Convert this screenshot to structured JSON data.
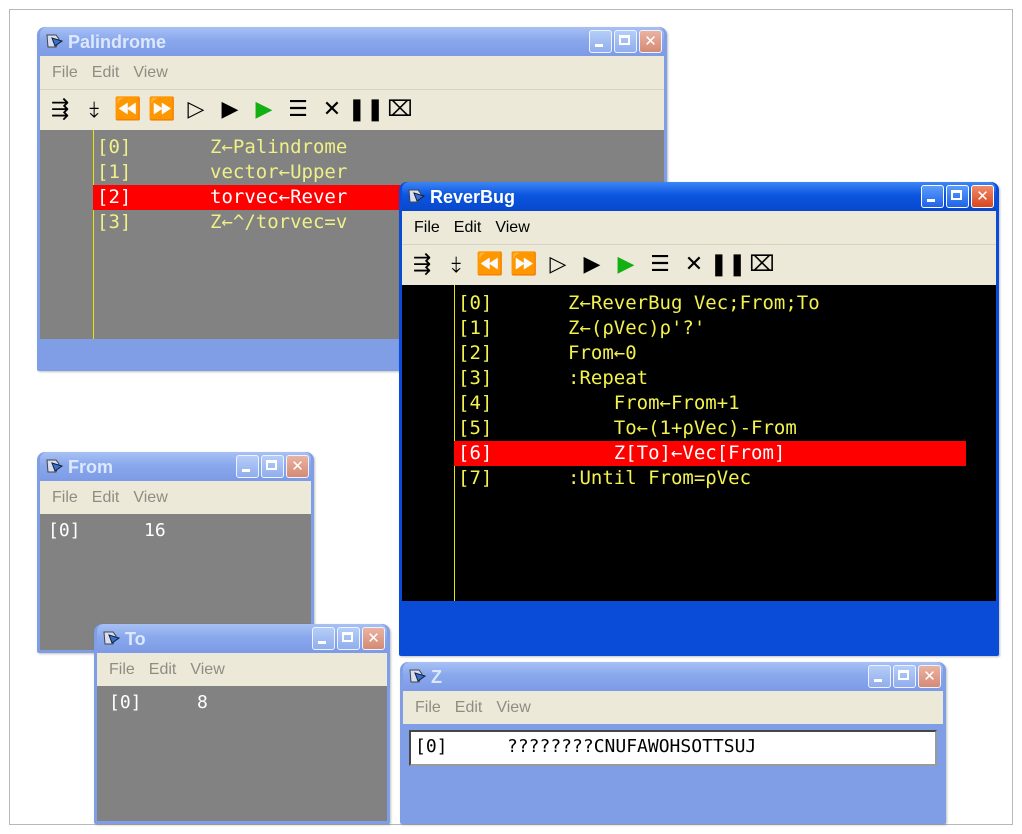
{
  "menu": [
    "File",
    "Edit",
    "View"
  ],
  "toolbar_icons": [
    "step-over-icon",
    "step-into-icon",
    "rewind-icon",
    "fast-forward-icon",
    "run-line-icon",
    "run-icon",
    "continue-icon",
    "edit-trace-icon",
    "quit-icon",
    "pause-icon",
    "interrupt-icon"
  ],
  "palindrome": {
    "title": "Palindrome",
    "lines": [
      {
        "n": "[0]",
        "t": "Z←Palindrome"
      },
      {
        "n": "[1]",
        "t": "vector←Upper"
      },
      {
        "n": "[2]",
        "t": "torvec←Rever",
        "hl": true
      },
      {
        "n": "[3]",
        "t": "Z←^/torvec=v"
      }
    ]
  },
  "reverbug": {
    "title": "ReverBug",
    "lines": [
      {
        "n": "[0]",
        "t": "Z←ReverBug Vec;From;To"
      },
      {
        "n": "[1]",
        "t": "Z←(⍴Vec)⍴'?'"
      },
      {
        "n": "[2]",
        "t": "From←0"
      },
      {
        "n": "[3]",
        "t": ":Repeat"
      },
      {
        "n": "[4]",
        "t": "    From←From+1"
      },
      {
        "n": "[5]",
        "t": "    To←(1+⍴Vec)-From"
      },
      {
        "n": "[6]",
        "t": "    Z[To]←Vec[From]",
        "hl": true
      },
      {
        "n": "[7]",
        "t": ":Until From=⍴Vec"
      }
    ]
  },
  "from_win": {
    "title": "From",
    "index": "[0]",
    "value": "16"
  },
  "to_win": {
    "title": "To",
    "index": "[0]",
    "value": "8"
  },
  "z_win": {
    "title": "Z",
    "index": "[0]",
    "value": "????????CNUFAWOHSOTTSUJ"
  },
  "colors": {
    "active_title": "#0b55e0",
    "inactive_title": "#89a8ec",
    "highlight": "#ff0000",
    "code_text": "#f2f24e",
    "inactive_code_bg": "#828282"
  }
}
